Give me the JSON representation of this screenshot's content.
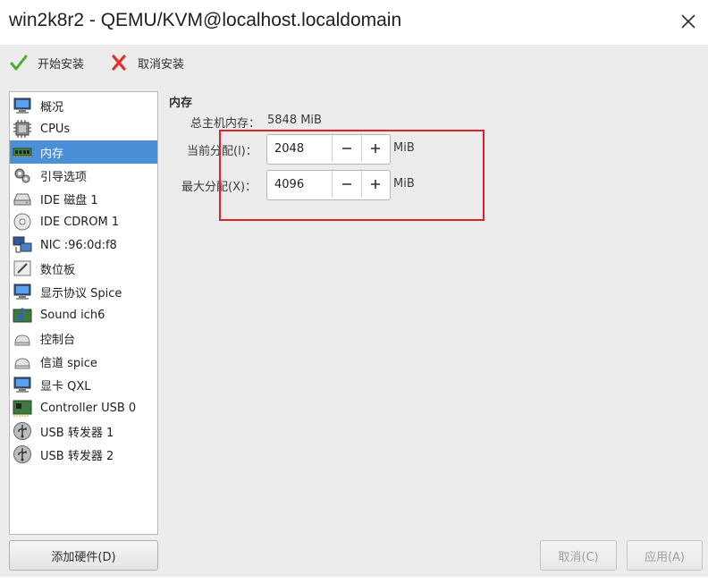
{
  "window": {
    "title": "win2k8r2 - QEMU/KVM@localhost.localdomain"
  },
  "toolbar": {
    "begin_install": "开始安装",
    "cancel_install": "取消安装"
  },
  "sidebar": {
    "items": [
      {
        "label": "概况",
        "icon": "overview-monitor-icon"
      },
      {
        "label": "CPUs",
        "icon": "cpu-chip-icon"
      },
      {
        "label": "内存",
        "icon": "memory-module-icon",
        "selected": true
      },
      {
        "label": "引导选项",
        "icon": "boot-gears-icon"
      },
      {
        "label": "IDE 磁盘 1",
        "icon": "hard-disk-icon"
      },
      {
        "label": "IDE CDROM 1",
        "icon": "cdrom-icon"
      },
      {
        "label": "NIC :96:0d:f8",
        "icon": "network-icon"
      },
      {
        "label": "数位板",
        "icon": "tablet-icon"
      },
      {
        "label": "显示协议 Spice",
        "icon": "display-monitor-icon"
      },
      {
        "label": "Sound ich6",
        "icon": "sound-card-icon"
      },
      {
        "label": "控制台",
        "icon": "serial-console-icon"
      },
      {
        "label": "信道 spice",
        "icon": "channel-icon"
      },
      {
        "label": "显卡 QXL",
        "icon": "video-card-icon"
      },
      {
        "label": "Controller USB 0",
        "icon": "controller-card-icon"
      },
      {
        "label": "USB 转发器 1",
        "icon": "usb-redirector-icon"
      },
      {
        "label": "USB 转发器 2",
        "icon": "usb-redirector-icon"
      }
    ],
    "add_hardware": "添加硬件(D)"
  },
  "memory": {
    "section_title": "内存",
    "host_memory_label": "总主机内存：",
    "host_memory_value": "5848 MiB",
    "current_label": "当前分配(l)：",
    "current_value": "2048",
    "max_label": "最大分配(X)：",
    "max_value": "4096",
    "unit": "MiB"
  },
  "actions": {
    "cancel": "取消(C)",
    "apply": "应用(A)"
  },
  "colors": {
    "selection": "#4a90d9",
    "highlight_box": "#e0202a",
    "install_check": "#4caf2a",
    "cancel_cross": "#e03030"
  }
}
